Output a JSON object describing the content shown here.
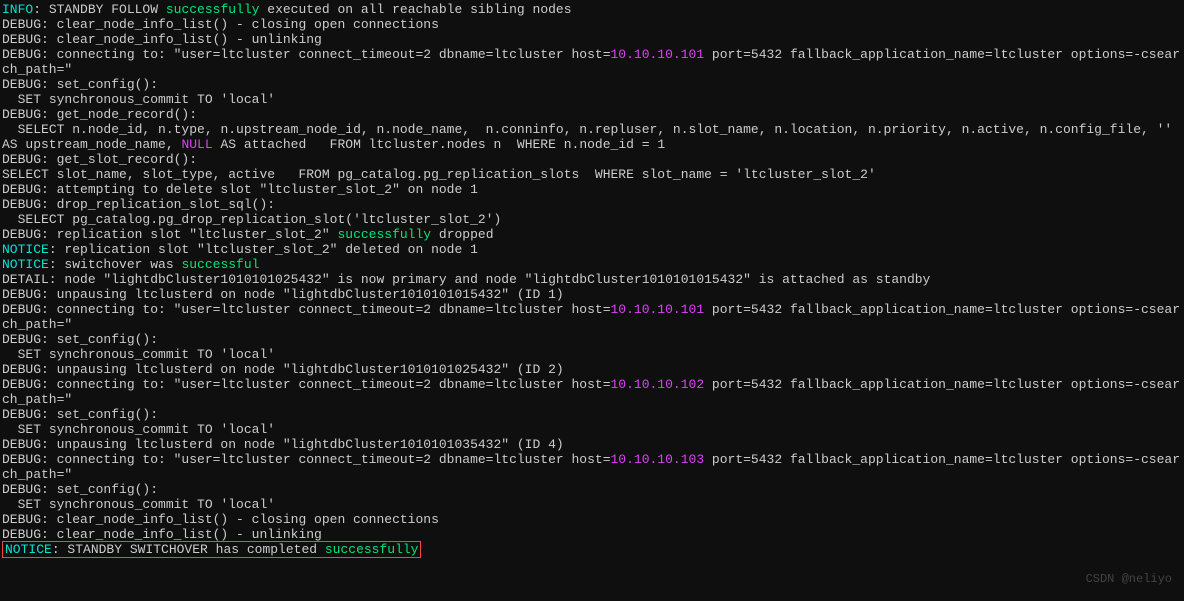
{
  "watermark": "CSDN @neliyo",
  "log": {
    "lines": [
      {
        "spans": [
          {
            "c": "kw-cyan",
            "t": "INFO"
          },
          {
            "t": ": STANDBY FOLLOW "
          },
          {
            "c": "kw-green",
            "t": "successfully"
          },
          {
            "t": " executed on all reachable sibling nodes"
          }
        ]
      },
      {
        "spans": [
          {
            "t": "DEBUG: clear_node_info_list() - closing open connections"
          }
        ]
      },
      {
        "spans": [
          {
            "t": "DEBUG: clear_node_info_list() - unlinking"
          }
        ]
      },
      {
        "spans": [
          {
            "t": "DEBUG: connecting to: \"user=ltcluster connect_timeout=2 dbname=ltcluster host="
          },
          {
            "c": "kw-magenta",
            "t": "10.10.10.101"
          },
          {
            "t": " port=5432 fallback_application_name=ltcluster options=-csearch_path=\""
          }
        ]
      },
      {
        "spans": [
          {
            "t": "DEBUG: set_config():"
          }
        ]
      },
      {
        "spans": [
          {
            "t": "  SET synchronous_commit TO 'local'"
          }
        ]
      },
      {
        "spans": [
          {
            "t": "DEBUG: get_node_record():"
          }
        ]
      },
      {
        "spans": [
          {
            "t": "  SELECT n.node_id, n.type, n.upstream_node_id, n.node_name,  n.conninfo, n.repluser, n.slot_name, n.location, n.priority, n.active, n.config_file, '' AS upstream_node_name, "
          },
          {
            "c": "kw-magenta",
            "t": "NULL"
          },
          {
            "t": " AS attached   FROM ltcluster.nodes n  WHERE n.node_id = 1"
          }
        ]
      },
      {
        "spans": [
          {
            "t": "DEBUG: get_slot_record():"
          }
        ]
      },
      {
        "spans": [
          {
            "t": "SELECT slot_name, slot_type, active   FROM pg_catalog.pg_replication_slots  WHERE slot_name = 'ltcluster_slot_2'"
          }
        ]
      },
      {
        "spans": [
          {
            "t": "DEBUG: attempting to delete slot \"ltcluster_slot_2\" on node 1"
          }
        ]
      },
      {
        "spans": [
          {
            "t": "DEBUG: drop_replication_slot_sql():"
          }
        ]
      },
      {
        "spans": [
          {
            "t": "  SELECT pg_catalog.pg_drop_replication_slot('ltcluster_slot_2')"
          }
        ]
      },
      {
        "spans": [
          {
            "t": "DEBUG: replication slot \"ltcluster_slot_2\" "
          },
          {
            "c": "kw-green",
            "t": "successfully"
          },
          {
            "t": " dropped"
          }
        ]
      },
      {
        "spans": [
          {
            "c": "kw-cyan",
            "t": "NOTICE"
          },
          {
            "t": ": replication slot \"ltcluster_slot_2\" deleted on node 1"
          }
        ]
      },
      {
        "spans": [
          {
            "c": "kw-cyan",
            "t": "NOTICE"
          },
          {
            "t": ": switchover was "
          },
          {
            "c": "kw-green",
            "t": "successful"
          }
        ]
      },
      {
        "spans": [
          {
            "t": "DETAIL: node \"lightdbCluster1010101025432\" is now primary and node \"lightdbCluster1010101015432\" is attached as standby"
          }
        ]
      },
      {
        "spans": [
          {
            "t": "DEBUG: unpausing ltclusterd on node \"lightdbCluster1010101015432\" (ID 1)"
          }
        ]
      },
      {
        "spans": [
          {
            "t": "DEBUG: connecting to: \"user=ltcluster connect_timeout=2 dbname=ltcluster host="
          },
          {
            "c": "kw-magenta",
            "t": "10.10.10.101"
          },
          {
            "t": " port=5432 fallback_application_name=ltcluster options=-csearch_path=\""
          }
        ]
      },
      {
        "spans": [
          {
            "t": "DEBUG: set_config():"
          }
        ]
      },
      {
        "spans": [
          {
            "t": "  SET synchronous_commit TO 'local'"
          }
        ]
      },
      {
        "spans": [
          {
            "t": "DEBUG: unpausing ltclusterd on node \"lightdbCluster1010101025432\" (ID 2)"
          }
        ]
      },
      {
        "spans": [
          {
            "t": "DEBUG: connecting to: \"user=ltcluster connect_timeout=2 dbname=ltcluster host="
          },
          {
            "c": "kw-magenta",
            "t": "10.10.10.102"
          },
          {
            "t": " port=5432 fallback_application_name=ltcluster options=-csearch_path=\""
          }
        ]
      },
      {
        "spans": [
          {
            "t": "DEBUG: set_config():"
          }
        ]
      },
      {
        "spans": [
          {
            "t": "  SET synchronous_commit TO 'local'"
          }
        ]
      },
      {
        "spans": [
          {
            "t": "DEBUG: unpausing ltclusterd on node \"lightdbCluster1010101035432\" (ID 4)"
          }
        ]
      },
      {
        "spans": [
          {
            "t": "DEBUG: connecting to: \"user=ltcluster connect_timeout=2 dbname=ltcluster host="
          },
          {
            "c": "kw-magenta",
            "t": "10.10.10.103"
          },
          {
            "t": " port=5432 fallback_application_name=ltcluster options=-csearch_path=\""
          }
        ]
      },
      {
        "spans": [
          {
            "t": "DEBUG: set_config():"
          }
        ]
      },
      {
        "spans": [
          {
            "t": "  SET synchronous_commit TO 'local'"
          }
        ]
      },
      {
        "spans": [
          {
            "t": "DEBUG: clear_node_info_list() - closing open connections"
          }
        ]
      },
      {
        "spans": [
          {
            "t": "DEBUG: clear_node_info_list() - unlinking"
          }
        ]
      },
      {
        "highlight": true,
        "spans": [
          {
            "c": "kw-cyan",
            "t": "NOTICE"
          },
          {
            "t": ": STANDBY SWITCHOVER has completed "
          },
          {
            "c": "kw-green",
            "t": "successfully"
          }
        ]
      }
    ]
  }
}
